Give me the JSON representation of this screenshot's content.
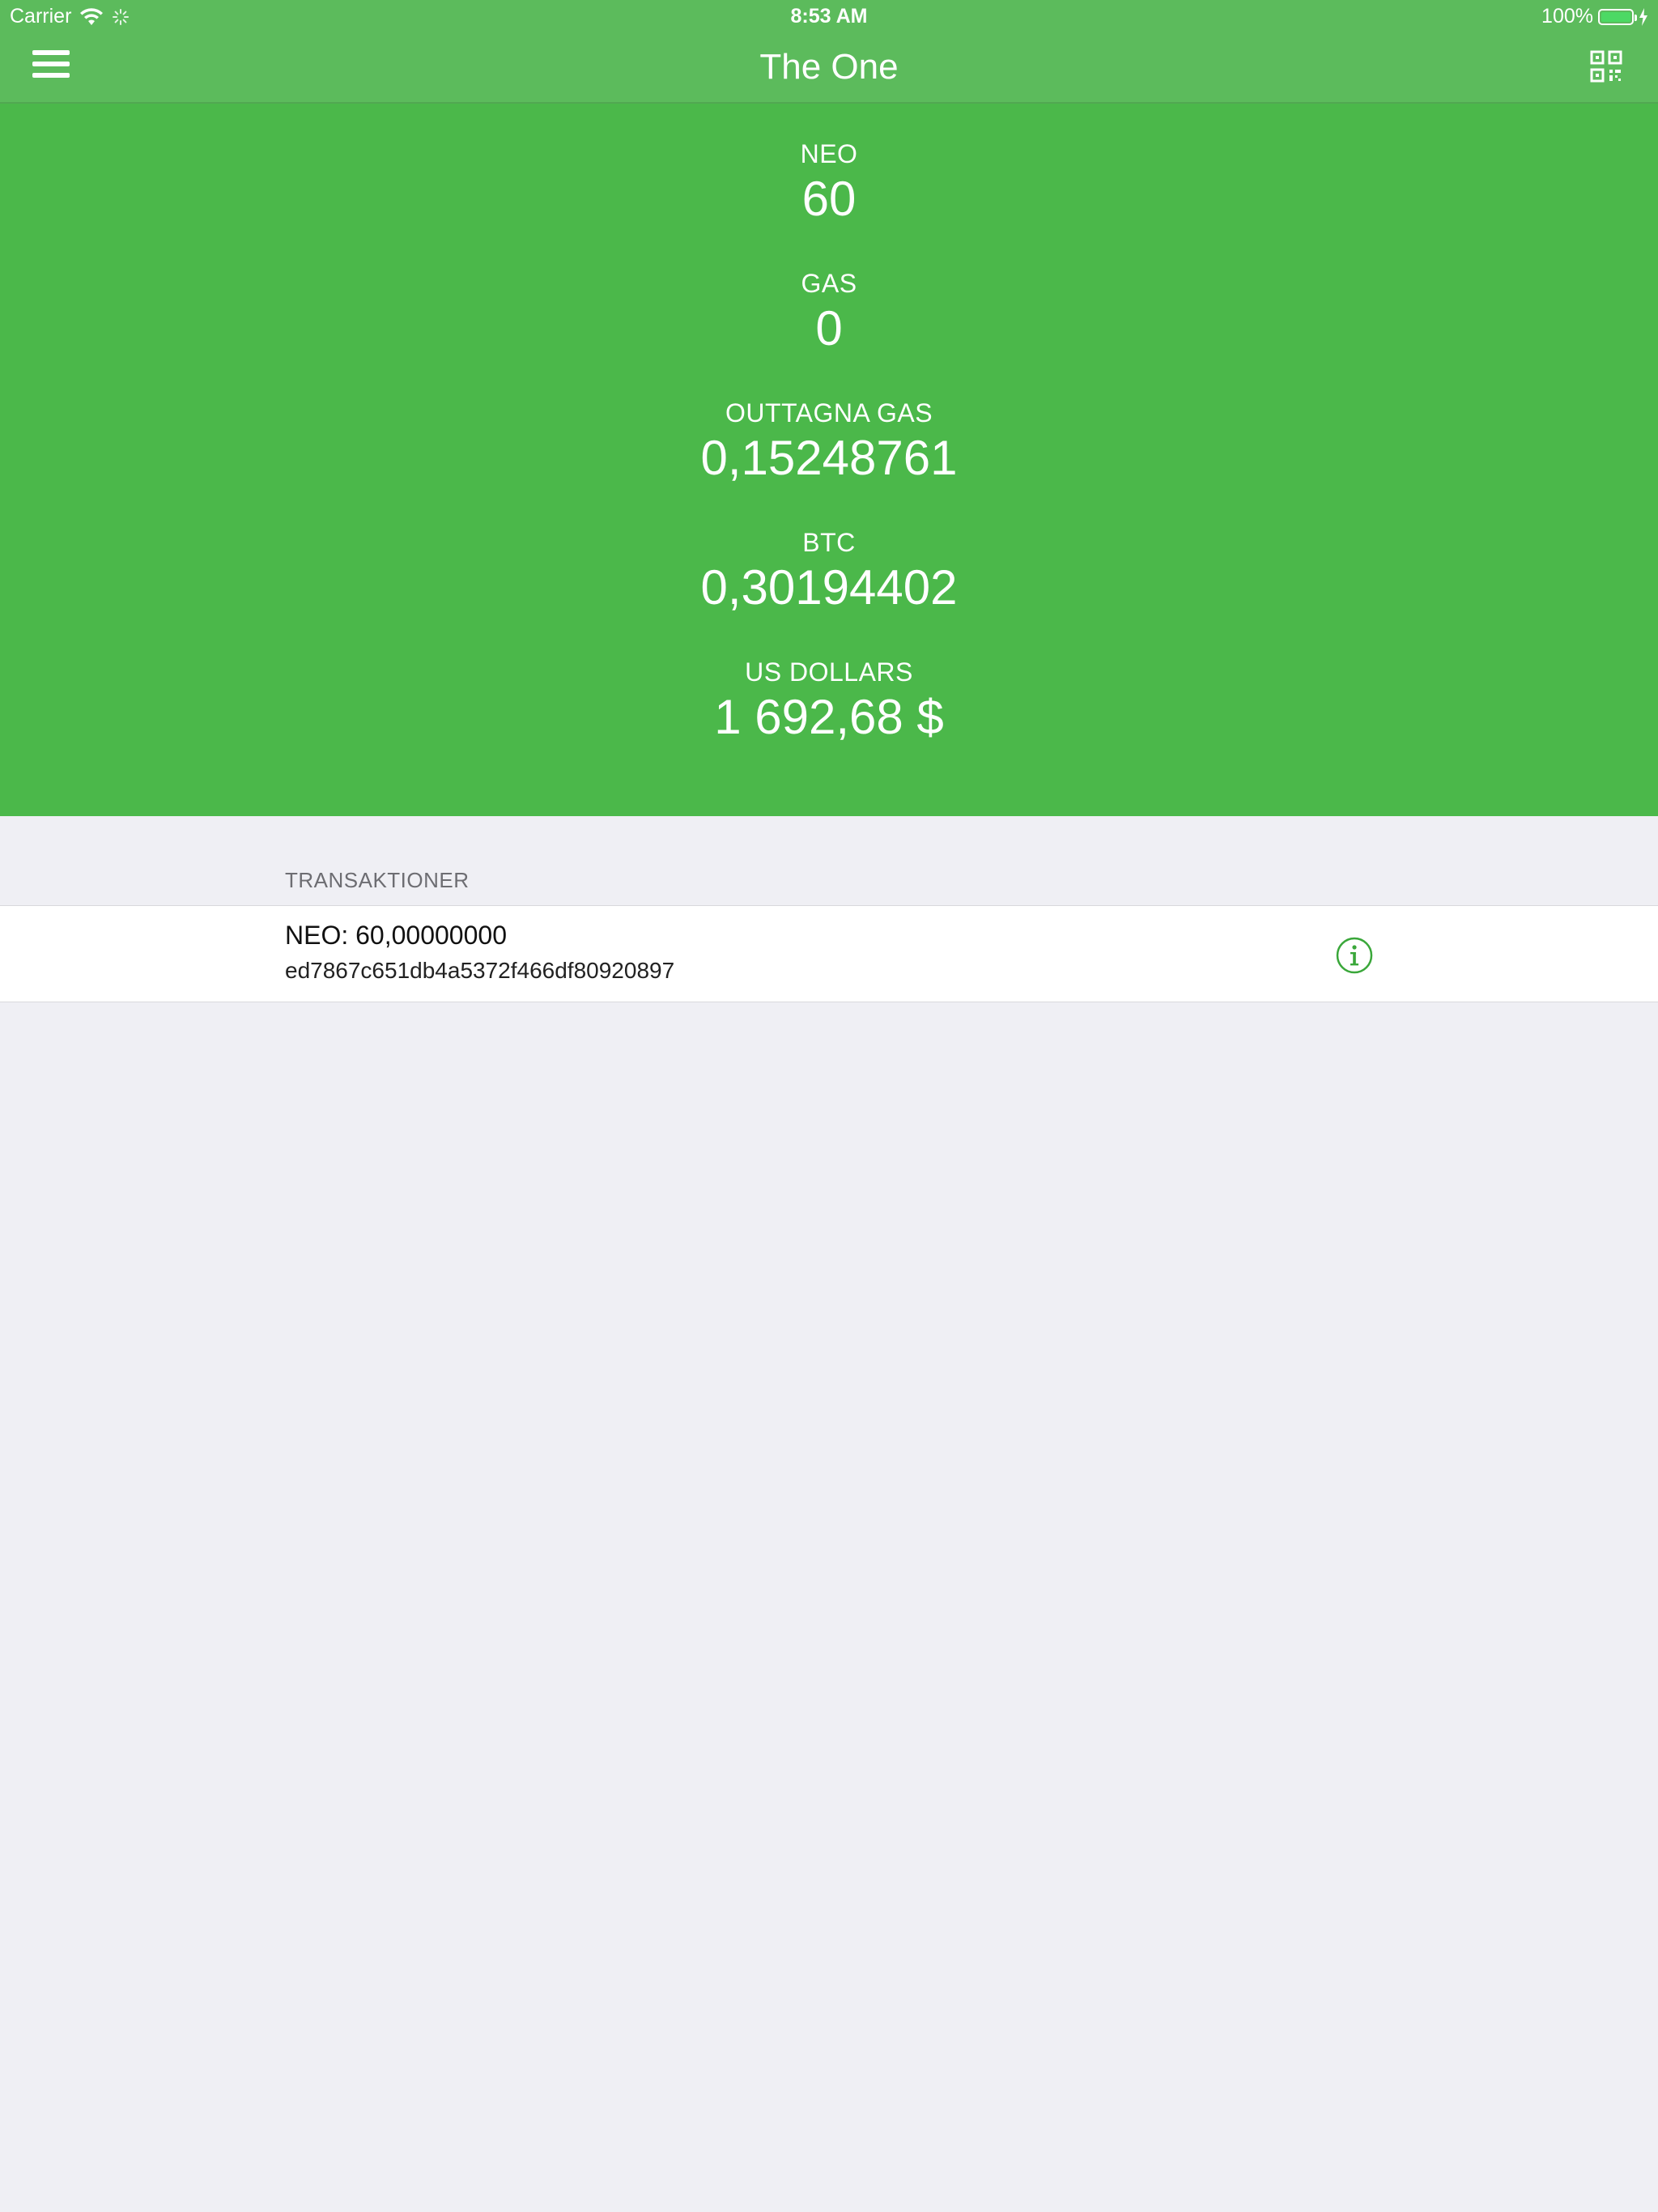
{
  "status_bar": {
    "carrier": "Carrier",
    "time": "8:53 AM",
    "battery": "100%",
    "battery_level": 1.0
  },
  "nav": {
    "title": "The One",
    "menu_icon": "hamburger-menu-icon",
    "qr_icon": "qr-code-icon"
  },
  "balances": [
    {
      "label": "NEO",
      "value": "60"
    },
    {
      "label": "GAS",
      "value": "0"
    },
    {
      "label": "OUTTAGNA GAS",
      "value": "0,15248761"
    },
    {
      "label": "BTC",
      "value": "0,30194402"
    },
    {
      "label": "US DOLLARS",
      "value": "1 692,68 $"
    }
  ],
  "transactions": {
    "header": "TRANSAKTIONER",
    "items": [
      {
        "title": "NEO: 60,00000000",
        "hash": "ed7867c651db4a5372f466df80920897",
        "icon": "info-icon"
      }
    ]
  },
  "colors": {
    "header_green": "#5cbb5c",
    "panel_green": "#4bb84a",
    "accent_green": "#3aa73a",
    "background": "#efeff4"
  }
}
